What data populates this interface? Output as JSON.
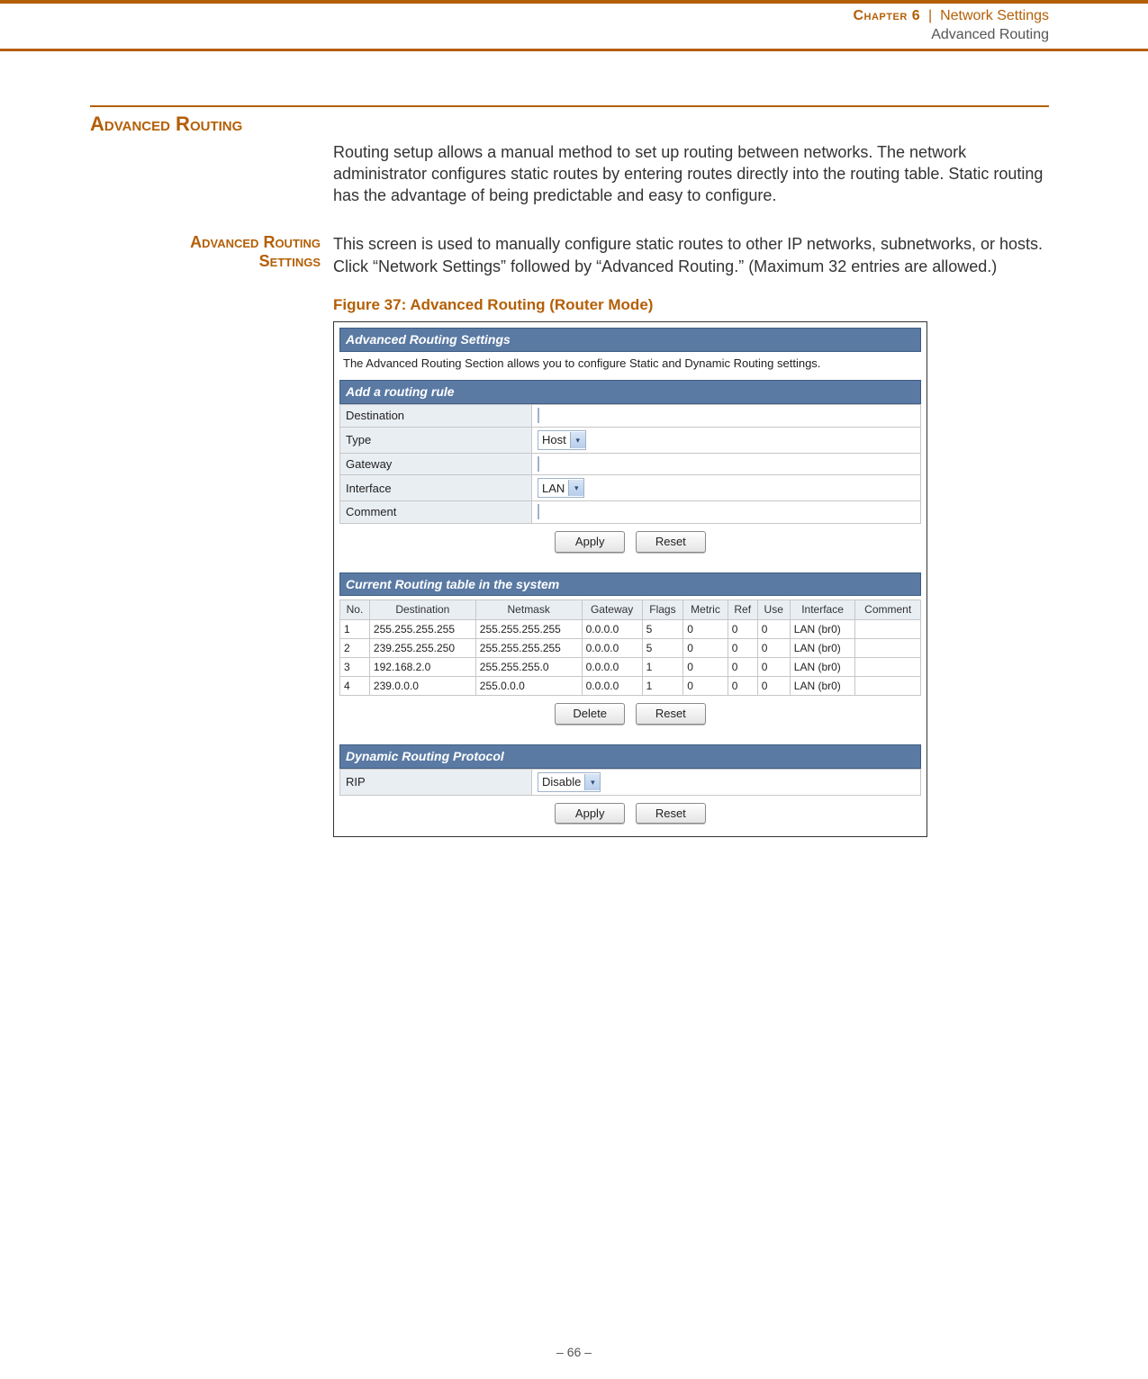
{
  "header": {
    "chapter": "Chapter 6",
    "breadcrumb": "Network Settings",
    "sub": "Advanced Routing"
  },
  "section_title": "Advanced Routing",
  "intro_text": "Routing setup allows a manual method to set up routing between networks. The network administrator configures static routes by entering routes directly into the routing table. Static routing has the advantage of being predictable and easy to configure.",
  "subsection_title_line1": "Advanced Routing",
  "subsection_title_line2": "Settings",
  "subsection_text": "This screen is used to manually configure static routes to other IP networks, subnetworks, or hosts. Click “Network Settings” followed by “Advanced Routing.” (Maximum 32 entries are allowed.)",
  "figure_caption": "Figure 37:  Advanced Routing (Router Mode)",
  "panel1": {
    "title": "Advanced Routing Settings",
    "desc": "The Advanced Routing Section allows you to configure Static and Dynamic Routing settings."
  },
  "panel2": {
    "title": "Add a routing rule",
    "fields": {
      "destination_label": "Destination",
      "type_label": "Type",
      "type_value": "Host",
      "gateway_label": "Gateway",
      "interface_label": "Interface",
      "interface_value": "LAN",
      "comment_label": "Comment"
    },
    "buttons": {
      "apply": "Apply",
      "reset": "Reset"
    }
  },
  "panel3": {
    "title": "Current Routing table in the system",
    "columns": [
      "No.",
      "Destination",
      "Netmask",
      "Gateway",
      "Flags",
      "Metric",
      "Ref",
      "Use",
      "Interface",
      "Comment"
    ],
    "rows": [
      {
        "no": "1",
        "destination": "255.255.255.255",
        "netmask": "255.255.255.255",
        "gateway": "0.0.0.0",
        "flags": "5",
        "metric": "0",
        "ref": "0",
        "use": "0",
        "interface": "LAN (br0)",
        "comment": ""
      },
      {
        "no": "2",
        "destination": "239.255.255.250",
        "netmask": "255.255.255.255",
        "gateway": "0.0.0.0",
        "flags": "5",
        "metric": "0",
        "ref": "0",
        "use": "0",
        "interface": "LAN (br0)",
        "comment": ""
      },
      {
        "no": "3",
        "destination": "192.168.2.0",
        "netmask": "255.255.255.0",
        "gateway": "0.0.0.0",
        "flags": "1",
        "metric": "0",
        "ref": "0",
        "use": "0",
        "interface": "LAN (br0)",
        "comment": ""
      },
      {
        "no": "4",
        "destination": "239.0.0.0",
        "netmask": "255.0.0.0",
        "gateway": "0.0.0.0",
        "flags": "1",
        "metric": "0",
        "ref": "0",
        "use": "0",
        "interface": "LAN (br0)",
        "comment": ""
      }
    ],
    "buttons": {
      "delete": "Delete",
      "reset": "Reset"
    }
  },
  "panel4": {
    "title": "Dynamic Routing Protocol",
    "rip_label": "RIP",
    "rip_value": "Disable",
    "buttons": {
      "apply": "Apply",
      "reset": "Reset"
    }
  },
  "page_number": "–  66  –"
}
